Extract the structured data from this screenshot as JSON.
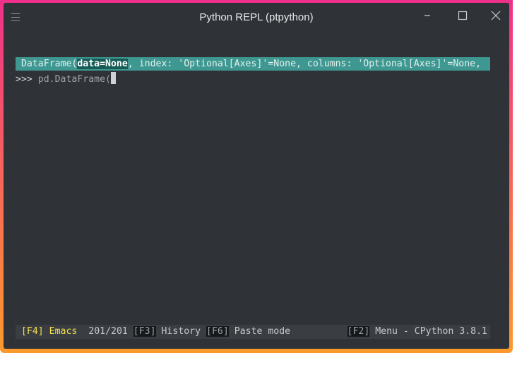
{
  "window": {
    "title": "Python REPL (ptpython)",
    "menu_icon": "hamburger-menu-icon",
    "buttons": [
      "minimize-icon",
      "maximize-icon",
      "close-icon"
    ]
  },
  "terminal": {
    "prompt": ">>>",
    "input": "pd.DataFrame(",
    "signature": {
      "func": "DataFrame(",
      "current_arg": "data=None",
      "rest": ", index: 'Optional[Axes]'=None, columns: 'Optional[Axes]'=None,"
    }
  },
  "statusbar": {
    "mode": "[F4] Emacs",
    "history_pos": "201/201",
    "f3_key": "[F3]",
    "f3_label": " History ",
    "f6_key": "[F6]",
    "f6_label": " Paste mode",
    "f2_key": "[F2]",
    "f2_label": " Menu - CPython 3.8.1"
  },
  "colors": {
    "frame_top": "#f0308a",
    "frame_bottom": "#fb9a2c",
    "background": "#2f3337",
    "signature_bg": "#3e9891",
    "mode_text": "#f2e04a"
  }
}
